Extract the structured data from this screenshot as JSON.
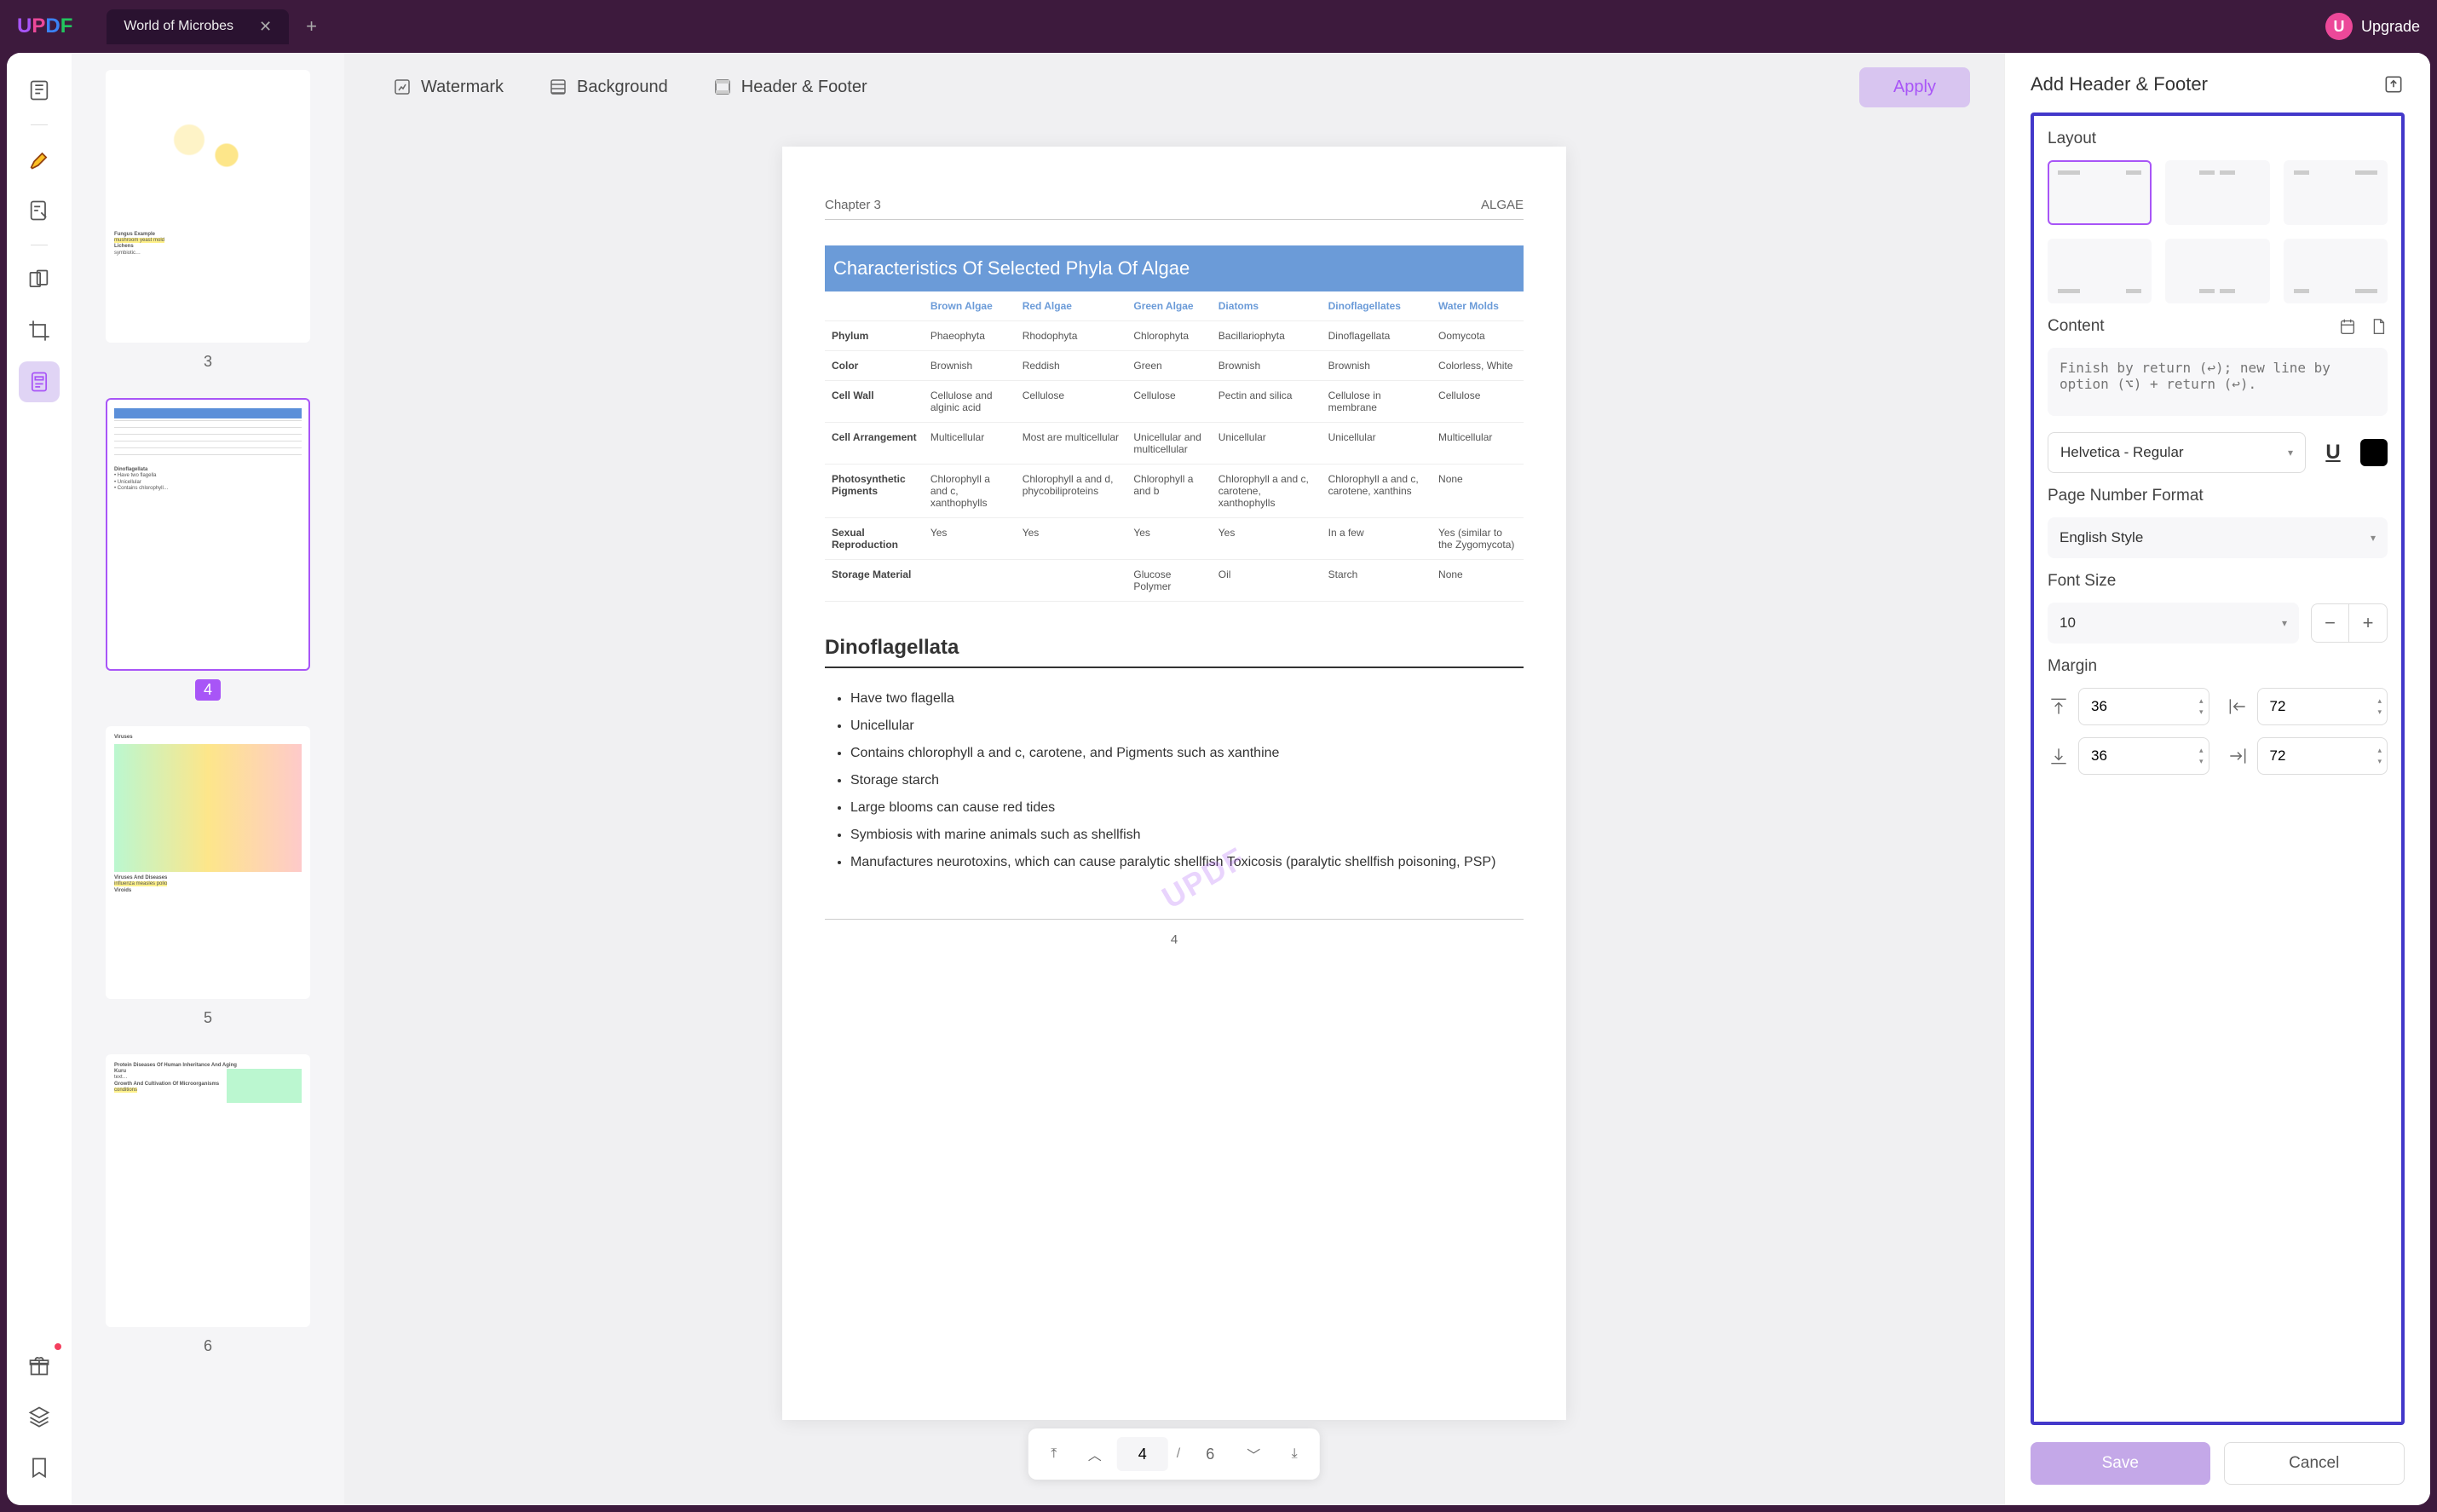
{
  "titlebar": {
    "tab_name": "World of Microbes",
    "upgrade_label": "Upgrade",
    "upgrade_initial": "U"
  },
  "doc_toolbar": {
    "watermark": "Watermark",
    "background": "Background",
    "header_footer": "Header & Footer",
    "apply": "Apply"
  },
  "thumbnails": [
    {
      "num": "3",
      "selected": false
    },
    {
      "num": "4",
      "selected": true
    },
    {
      "num": "5",
      "selected": false
    },
    {
      "num": "6",
      "selected": false
    }
  ],
  "page": {
    "chapter": "Chapter 3",
    "topic": "ALGAE",
    "table_title": "Characteristics Of Selected Phyla Of Algae",
    "watermark_text": "UPDF",
    "columns": [
      "",
      "Brown Algae",
      "Red Algae",
      "Green Algae",
      "Diatoms",
      "Dinoflagellates",
      "Water Molds"
    ],
    "rows": [
      [
        "Phylum",
        "Phaeophyta",
        "Rhodophyta",
        "Chlorophyta",
        "Bacillariophyta",
        "Dinoflagellata",
        "Oomycota"
      ],
      [
        "Color",
        "Brownish",
        "Reddish",
        "Green",
        "Brownish",
        "Brownish",
        "Colorless, White"
      ],
      [
        "Cell Wall",
        "Cellulose and alginic acid",
        "Cellulose",
        "Cellulose",
        "Pectin and silica",
        "Cellulose in membrane",
        "Cellulose"
      ],
      [
        "Cell Arrangement",
        "Multicellular",
        "Most are multicellular",
        "Unicellular and multicellular",
        "Unicellular",
        "Unicellular",
        "Multicellular"
      ],
      [
        "Photosynthetic Pigments",
        "Chlorophyll a and c, xanthophylls",
        "Chlorophyll a and d, phycobiliproteins",
        "Chlorophyll a and b",
        "Chlorophyll a and c, carotene, xanthophylls",
        "Chlorophyll a and c, carotene, xanthins",
        "None"
      ],
      [
        "Sexual Reproduction",
        "Yes",
        "Yes",
        "Yes",
        "Yes",
        "In a few",
        "Yes (similar to the Zygomycota)"
      ],
      [
        "Storage Material",
        "",
        "",
        "Glucose Polymer",
        "Oil",
        "Starch",
        "None"
      ]
    ],
    "section_title": "Dinoflagellata",
    "bullets": [
      "Have two flagella",
      "Unicellular",
      "Contains chlorophyll a and c, carotene, and Pigments such as xanthine",
      "Storage starch",
      "Large blooms can cause red tides",
      "Symbiosis with marine animals such as shellfish",
      "Manufactures neurotoxins, which can cause paralytic shellfish Toxicosis (paralytic shellfish poisoning, PSP)"
    ],
    "page_num": "4"
  },
  "pager": {
    "current": "4",
    "total": "6"
  },
  "panel": {
    "title": "Add Header & Footer",
    "layout_label": "Layout",
    "content_label": "Content",
    "content_placeholder": "Finish by return (↩); new line by option (⌥) + return (↩).",
    "font_value": "Helvetica - Regular",
    "underline_label": "U",
    "pnf_label": "Page Number Format",
    "pnf_value": "English Style",
    "fontsize_label": "Font Size",
    "fontsize_value": "10",
    "margin_label": "Margin",
    "margin_top": "36",
    "margin_bottom": "36",
    "margin_left": "72",
    "margin_right": "72",
    "save": "Save",
    "cancel": "Cancel"
  }
}
